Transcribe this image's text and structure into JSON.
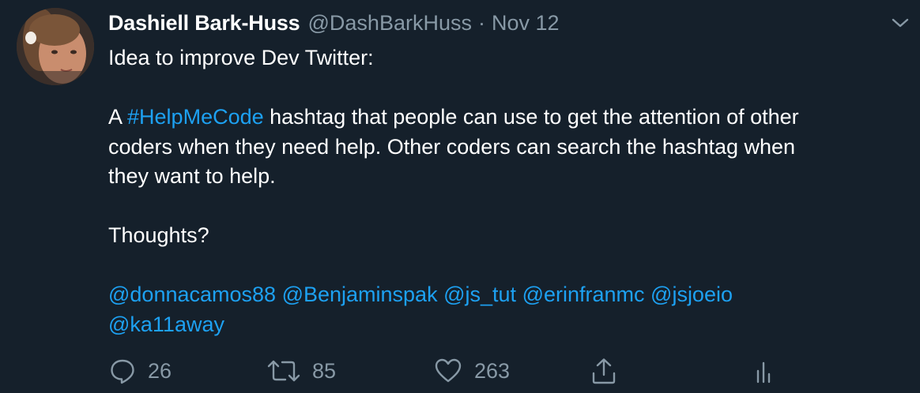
{
  "tweet": {
    "author_name": "Dashiell Bark-Huss",
    "author_handle": "@DashBarkHuss",
    "separator": "·",
    "date": "Nov 12",
    "text": {
      "line1": "Idea to improve Dev Twitter:",
      "line2_prefix": "A ",
      "hashtag": "#HelpMeCode",
      "line2_suffix": " hashtag that people can use to get the attention of other",
      "line3": "coders when they need help. Other coders can search the hashtag when",
      "line4": "they want to help.",
      "line5": "Thoughts?",
      "mentions": [
        "@donnacamos88",
        "@Benjaminspak",
        "@js_tut",
        "@erinfranmc",
        "@jsjoeio",
        "@ka11away"
      ]
    },
    "actions": {
      "reply_count": "26",
      "retweet_count": "85",
      "like_count": "263"
    },
    "icons": {
      "menu": "chevron-down-icon",
      "reply": "reply-icon",
      "retweet": "retweet-icon",
      "like": "heart-icon",
      "share": "share-icon",
      "analytics": "analytics-icon"
    },
    "colors": {
      "background": "#15202b",
      "text": "#ffffff",
      "muted": "#8899a6",
      "link": "#1da1f2"
    }
  }
}
